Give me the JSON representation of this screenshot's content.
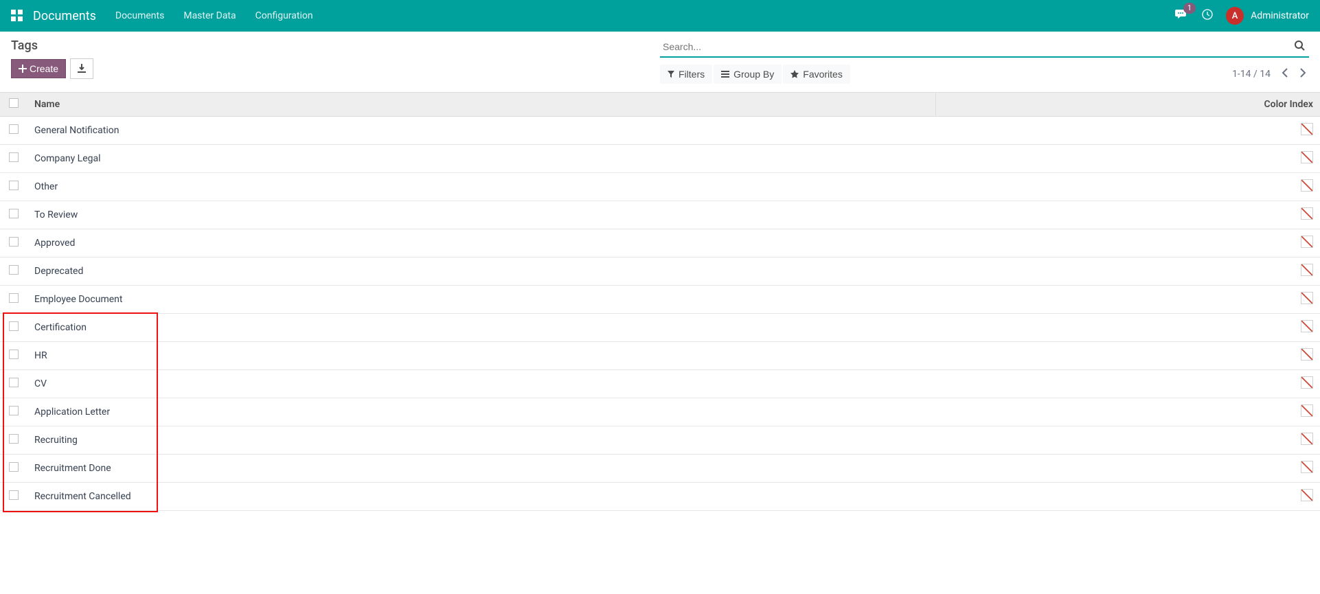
{
  "nav": {
    "brand": "Documents",
    "menu": [
      "Documents",
      "Master Data",
      "Configuration"
    ],
    "chat_badge": "1",
    "user_initial": "A",
    "user_name": "Administrator"
  },
  "breadcrumb": "Tags",
  "buttons": {
    "create": "Create"
  },
  "search": {
    "placeholder": "Search..."
  },
  "filters": {
    "filters": "Filters",
    "groupby": "Group By",
    "favorites": "Favorites"
  },
  "pager": "1-14 / 14",
  "columns": {
    "name": "Name",
    "color": "Color Index"
  },
  "rows": [
    {
      "name": "General Notification"
    },
    {
      "name": "Company Legal"
    },
    {
      "name": "Other"
    },
    {
      "name": "To Review"
    },
    {
      "name": "Approved"
    },
    {
      "name": "Deprecated"
    },
    {
      "name": "Employee Document"
    },
    {
      "name": "Certification"
    },
    {
      "name": "HR"
    },
    {
      "name": "CV"
    },
    {
      "name": "Application Letter"
    },
    {
      "name": "Recruiting"
    },
    {
      "name": "Recruitment Done"
    },
    {
      "name": "Recruitment Cancelled"
    }
  ]
}
